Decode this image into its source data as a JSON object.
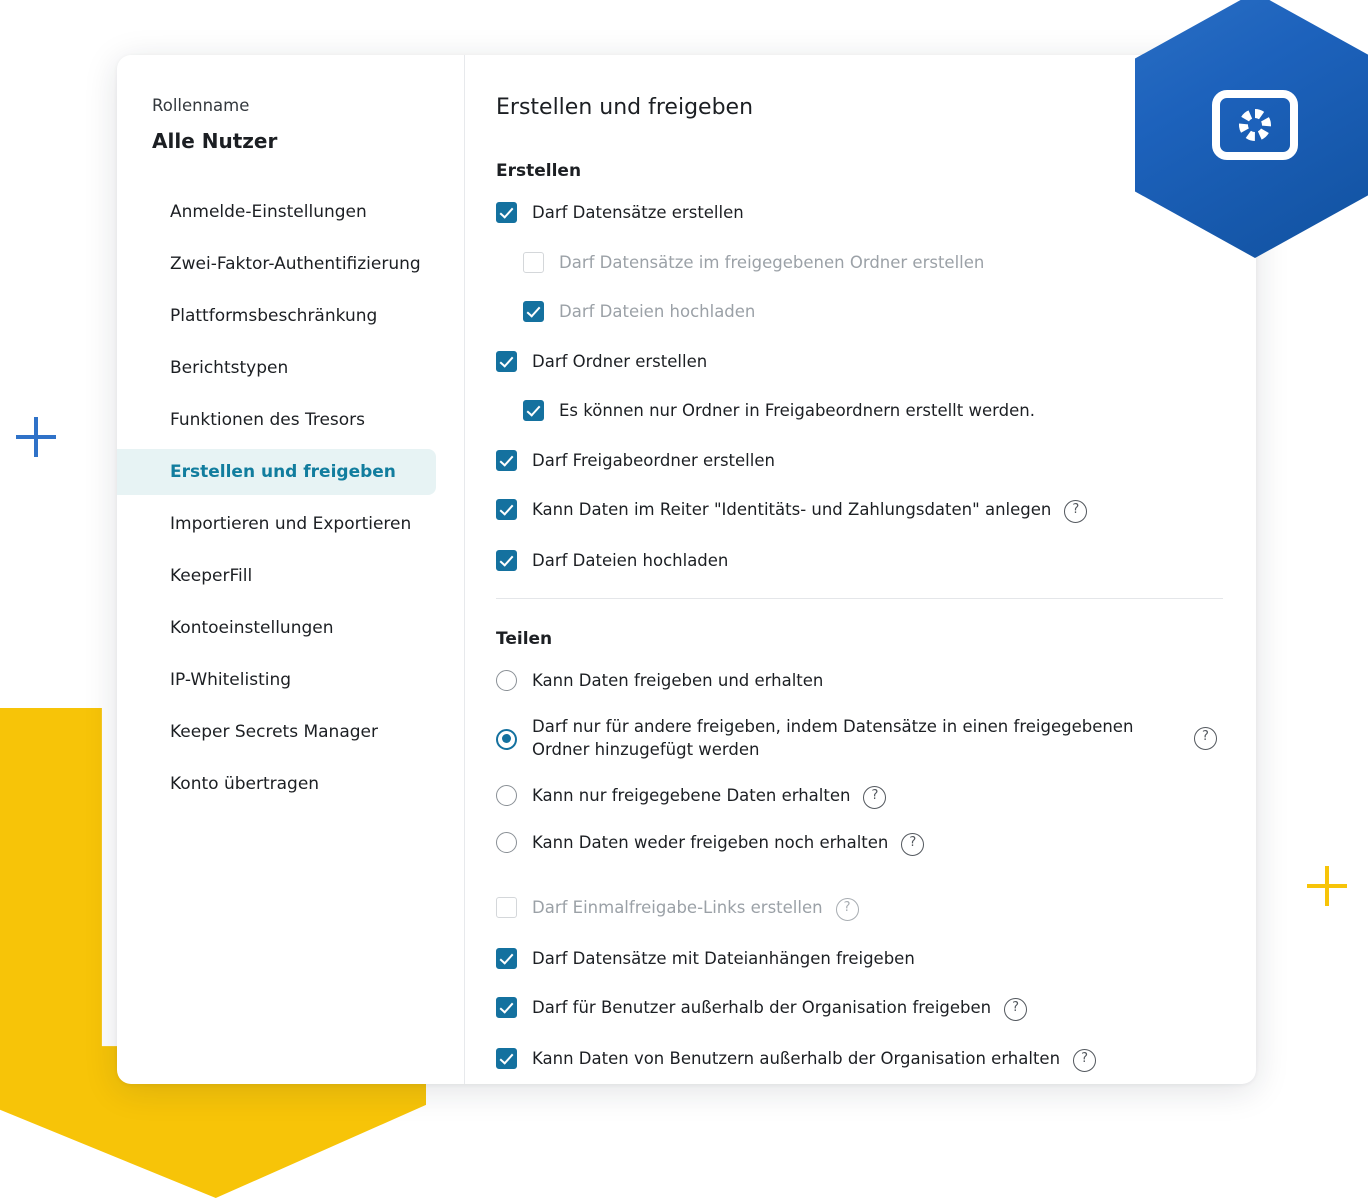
{
  "decor": {
    "hex_icon": "settings-window-gear-icon",
    "hex_color": "#1d62bc",
    "arrow_color": "#f7c408",
    "plus_blue_color": "#2f72c8",
    "plus_yellow_color": "#f7c408"
  },
  "sidebar": {
    "role_label": "Rollenname",
    "role_name": "Alle Nutzer",
    "items": [
      {
        "label": "Anmelde-Einstellungen",
        "active": false
      },
      {
        "label": "Zwei-Faktor-Authentifizierung",
        "active": false
      },
      {
        "label": "Plattformsbeschränkung",
        "active": false
      },
      {
        "label": "Berichtstypen",
        "active": false
      },
      {
        "label": "Funktionen des Tresors",
        "active": false
      },
      {
        "label": "Erstellen und freigeben",
        "active": true
      },
      {
        "label": "Importieren und Exportieren",
        "active": false
      },
      {
        "label": "KeeperFill",
        "active": false
      },
      {
        "label": "Kontoeinstellungen",
        "active": false
      },
      {
        "label": "IP-Whitelisting",
        "active": false
      },
      {
        "label": "Keeper Secrets Manager",
        "active": false
      },
      {
        "label": "Konto übertragen",
        "active": false
      }
    ],
    "active_bg": "#e7f3f4",
    "active_color": "#117d9e"
  },
  "main": {
    "title": "Erstellen und freigeben",
    "create_section": {
      "heading": "Erstellen",
      "options": [
        {
          "label": "Darf Datensätze erstellen",
          "checked": true,
          "indent": 0,
          "disabled": false,
          "help": false
        },
        {
          "label": "Darf Datensätze im freigegebenen Ordner erstellen",
          "checked": false,
          "indent": 1,
          "disabled": true,
          "help": false
        },
        {
          "label": "Darf Dateien hochladen",
          "checked": true,
          "indent": 1,
          "disabled": true,
          "help": false
        },
        {
          "label": "Darf Ordner erstellen",
          "checked": true,
          "indent": 0,
          "disabled": false,
          "help": false
        },
        {
          "label": "Es können nur Ordner in Freigabeordnern erstellt werden.",
          "checked": true,
          "indent": 1,
          "disabled": false,
          "help": false
        },
        {
          "label": "Darf Freigabeordner erstellen",
          "checked": true,
          "indent": 0,
          "disabled": false,
          "help": false
        },
        {
          "label": "Kann Daten im Reiter \"Identitäts- und Zahlungsdaten\" anlegen",
          "checked": true,
          "indent": 0,
          "disabled": false,
          "help": true
        },
        {
          "label": "Darf Dateien hochladen",
          "checked": true,
          "indent": 0,
          "disabled": false,
          "help": false
        }
      ]
    },
    "share_section": {
      "heading": "Teilen",
      "radios": [
        {
          "label": "Kann Daten freigeben und erhalten",
          "selected": false,
          "help": false
        },
        {
          "label": "Darf nur für andere freigeben, indem Datensätze in einen freigegebenen Ordner hinzugefügt werden",
          "selected": true,
          "help": true
        },
        {
          "label": "Kann nur freigegebene Daten erhalten",
          "selected": false,
          "help": true
        },
        {
          "label": "Kann Daten weder freigeben noch erhalten",
          "selected": false,
          "help": true
        }
      ],
      "options": [
        {
          "label": "Darf Einmalfreigabe-Links erstellen",
          "checked": false,
          "disabled": true,
          "help": true
        },
        {
          "label": "Darf Datensätze mit Dateianhängen freigeben",
          "checked": true,
          "disabled": false,
          "help": false
        },
        {
          "label": "Darf für Benutzer außerhalb der Organisation freigeben",
          "checked": true,
          "disabled": false,
          "help": true
        },
        {
          "label": "Kann Daten von Benutzern außerhalb der Organisation erhalten",
          "checked": true,
          "disabled": false,
          "help": true
        }
      ]
    },
    "help_icon_glyph": "?",
    "checkbox_checked_color": "#14719f",
    "radio_selected_color": "#14719f"
  }
}
